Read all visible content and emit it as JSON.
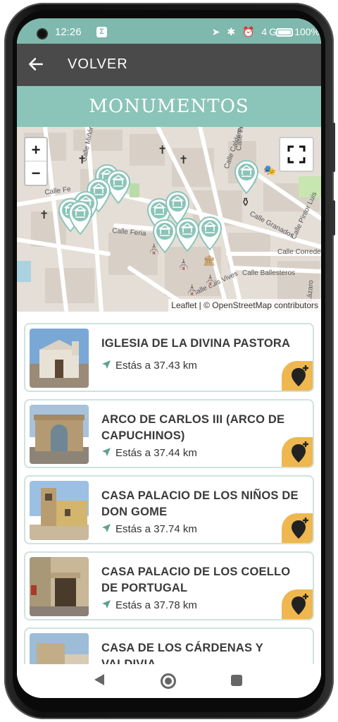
{
  "status_bar": {
    "time": "12:26",
    "sigma_icon": "Σ",
    "icons": "➤ ✱ ⏰ 4G",
    "battery": "100%"
  },
  "app_bar": {
    "back_label": "VOLVER"
  },
  "section": {
    "title": "MONUMENTOS"
  },
  "map": {
    "zoom_in": "+",
    "zoom_out": "−",
    "attribution": "Leaflet | © OpenStreetMap contributors",
    "street_labels": [
      "Calle Calderero",
      "Calle Feria",
      "Calle Granados",
      "Calle Pintor Luis",
      "Calle Corredera",
      "Calle Ballesteros",
      "Calle Luis Vives",
      "Calle Fe",
      "Calle Miñón",
      "Lázaro",
      "Calle Ponias"
    ],
    "marker_color": "#8bc4b8"
  },
  "monuments": [
    {
      "title": "IGLESIA DE LA DIVINA PASTORA",
      "distance": "Estás a 37.43 km"
    },
    {
      "title": "ARCO DE CARLOS III (ARCO DE CAPUCHINOS)",
      "distance": "Estás a 37.44 km"
    },
    {
      "title": "CASA PALACIO DE LOS NIÑOS DE DON GOME",
      "distance": "Estás a 37.74 km"
    },
    {
      "title": "CASA PALACIO DE LOS COELLO DE PORTUGAL",
      "distance": "Estás a 37.78 km"
    },
    {
      "title": "CASA DE LOS CÁRDENAS Y VALDIVIA",
      "distance": ""
    }
  ],
  "colors": {
    "status_bar": "#7fb8ad",
    "app_bar": "#4a4a4a",
    "header": "#8bc4b8",
    "card_border": "#cfe3de",
    "accent": "#efb74f",
    "distance_arrow": "#5fa090"
  }
}
